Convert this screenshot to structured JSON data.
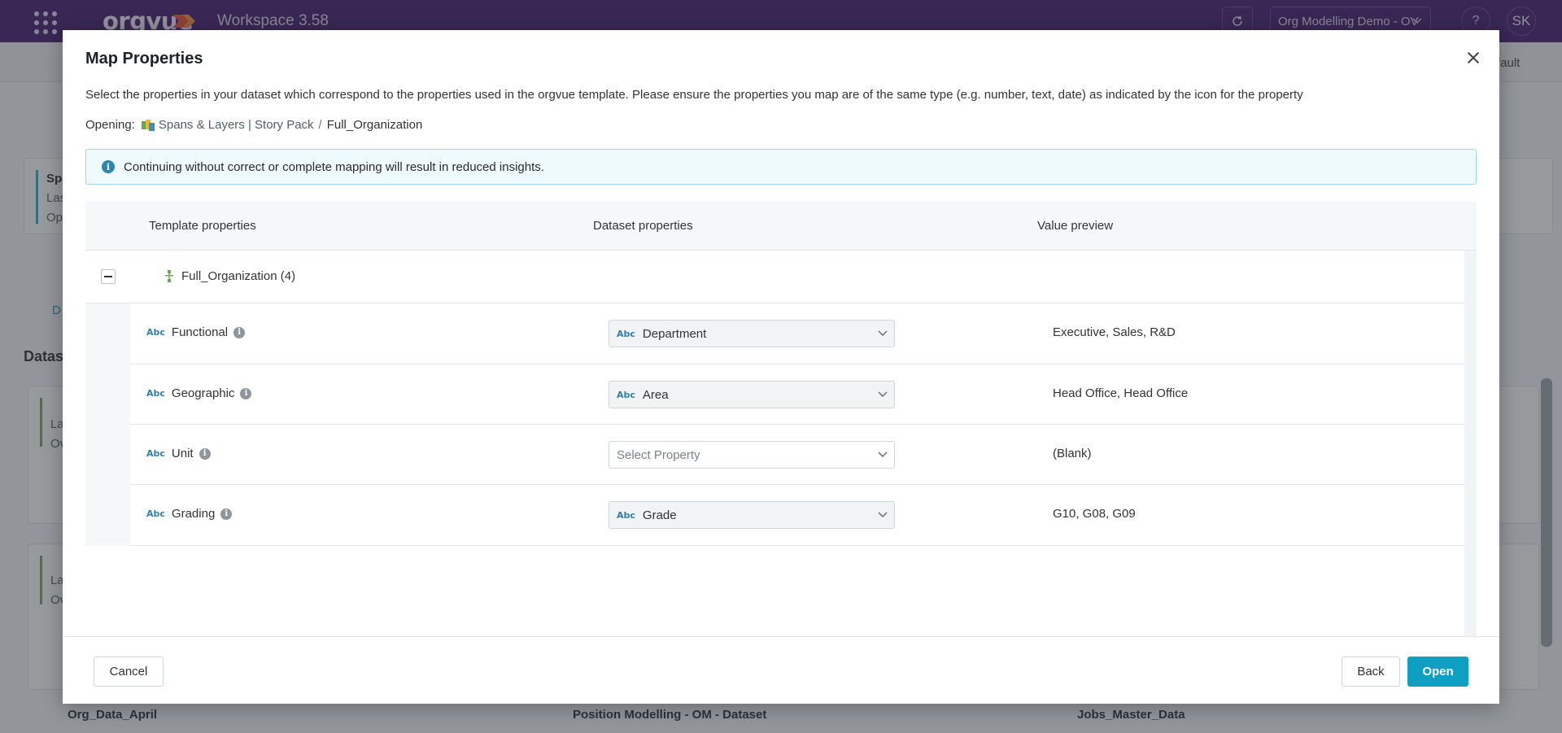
{
  "app": {
    "logo_text": "orgvue",
    "workspace_label": "Workspace  3.58",
    "org_selector": "Org Modelling Demo - OV",
    "help_label": "?",
    "user_initials": "SK"
  },
  "background": {
    "subbar_right_text": "fault",
    "cards": [
      {
        "title": "Spa",
        "line1": "Las",
        "line2": "Op"
      },
      {
        "title": "",
        "line1": "La",
        "line2": "Ov"
      },
      {
        "title": "",
        "line1": "La",
        "line2": "Ov"
      }
    ],
    "section_label": "Datas",
    "tab_label": "D",
    "bottom_cards": [
      {
        "title": "Org_Data_April"
      },
      {
        "title": "Position Modelling - OM - Dataset"
      },
      {
        "title": "Jobs_Master_Data"
      }
    ]
  },
  "modal": {
    "title": "Map Properties",
    "description": "Select the properties in your dataset which correspond to the properties used in the orgvue template. Please ensure the properties you map are of the same type (e.g. number, text, date) as indicated by the icon for the property",
    "opening_label": "Opening:",
    "opening_link": "Spans & Layers | Story Pack",
    "opening_separator": "/",
    "opening_current": "Full_Organization",
    "notice": "Continuing without correct or complete mapping will result in reduced insights.",
    "columns": {
      "template": "Template properties",
      "dataset": "Dataset properties",
      "preview": "Value preview"
    },
    "group": {
      "label": "Full_Organization (4)"
    },
    "type_label": "Abc",
    "rows": [
      {
        "template": "Functional",
        "dataset": "Department",
        "dataset_set": true,
        "preview": "Executive, Sales, R&D"
      },
      {
        "template": "Geographic",
        "dataset": "Area",
        "dataset_set": true,
        "preview": "Head Office, Head Office"
      },
      {
        "template": "Unit",
        "dataset": "Select Property",
        "dataset_set": false,
        "preview": "(Blank)"
      },
      {
        "template": "Grading",
        "dataset": "Grade",
        "dataset_set": true,
        "preview": "G10, G08, G09"
      }
    ],
    "buttons": {
      "cancel": "Cancel",
      "back": "Back",
      "open": "Open"
    },
    "colors": {
      "primary": "#0f9fc2",
      "header_bar": "#4a2271",
      "type_icon": "#2c7fb0"
    }
  }
}
